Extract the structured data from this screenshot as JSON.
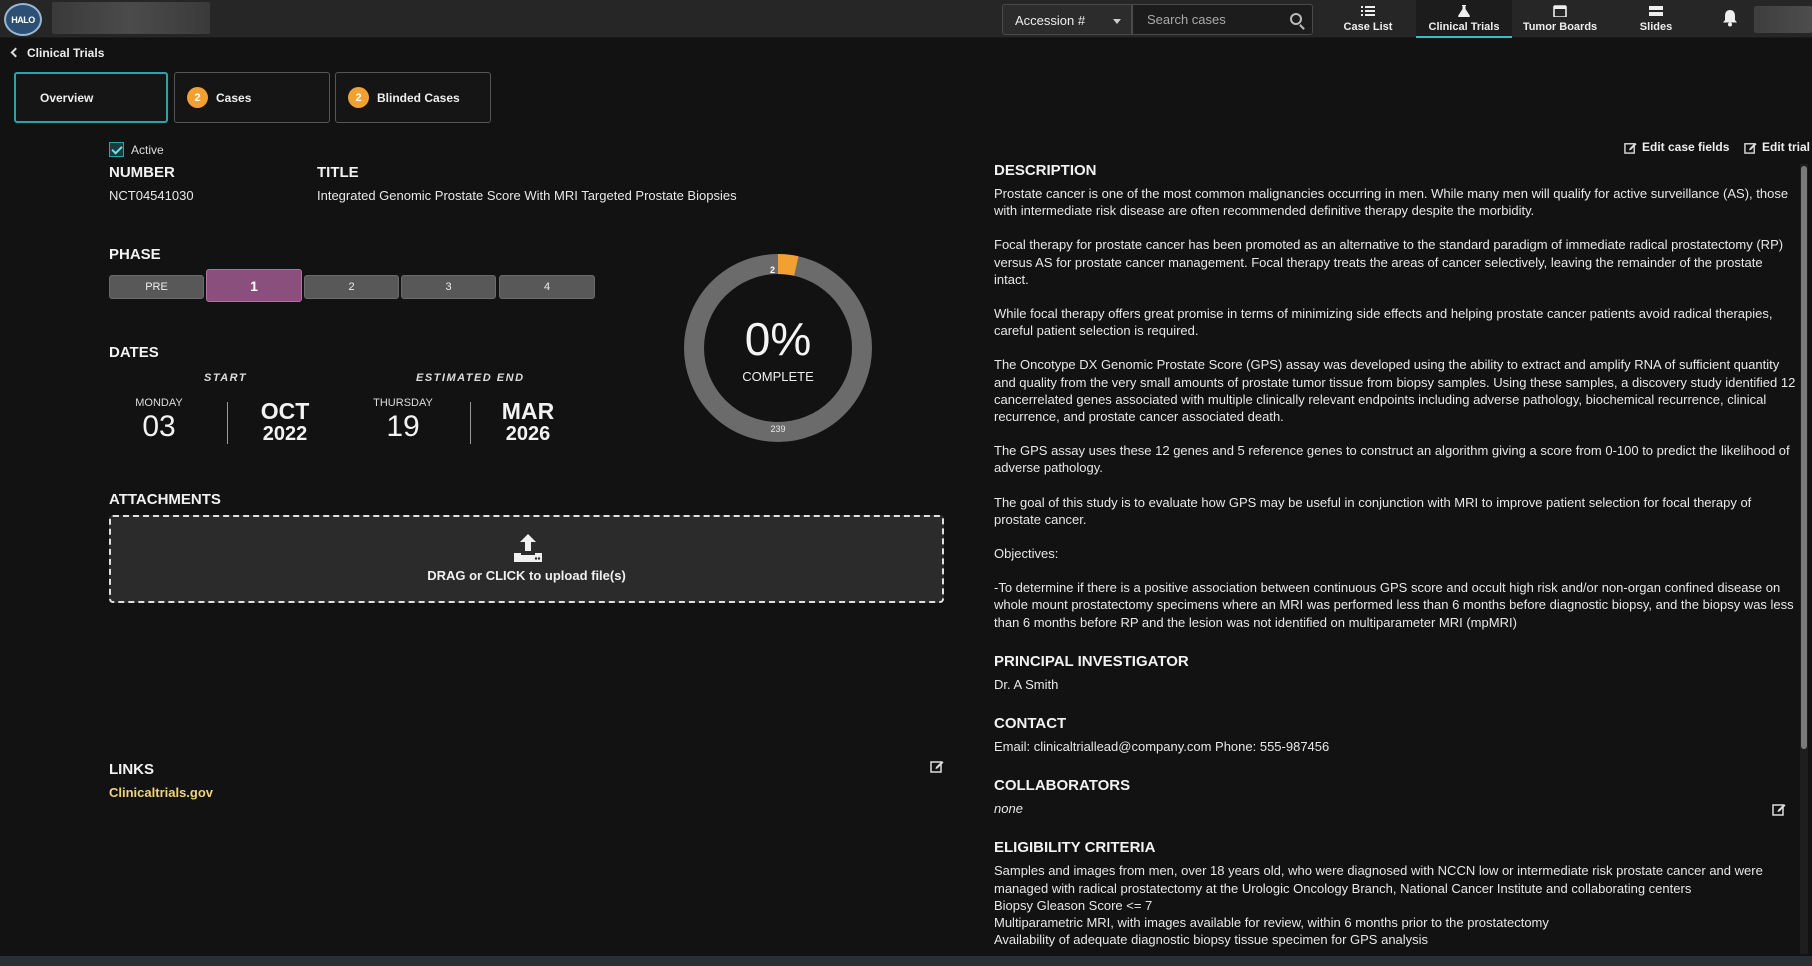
{
  "header": {
    "logo_text": "HALO",
    "accession_select": "Accession #",
    "search_placeholder": "Search cases",
    "nav": [
      {
        "label": "Case List",
        "icon": "list-icon"
      },
      {
        "label": "Clinical Trials",
        "icon": "flask-icon",
        "active": true
      },
      {
        "label": "Tumor Boards",
        "icon": "calendar-icon"
      },
      {
        "label": "Slides",
        "icon": "slides-icon"
      }
    ],
    "accent_color": "#2ec1c9"
  },
  "breadcrumb": "Clinical Trials",
  "subtabs": [
    {
      "label": "Overview",
      "badge": null,
      "active": true
    },
    {
      "label": "Cases",
      "badge": "2"
    },
    {
      "label": "Blinded Cases",
      "badge": "2"
    }
  ],
  "trial": {
    "active_label": "Active",
    "number_heading": "NUMBER",
    "number": "NCT04541030",
    "title_heading": "TITLE",
    "title": "Integrated Genomic Prostate Score With MRI Targeted Prostate Biopsies",
    "phase_heading": "PHASE",
    "phases": [
      "PRE",
      "1",
      "2",
      "3",
      "4"
    ],
    "active_phase": "1",
    "dates_heading": "DATES",
    "start": {
      "caption": "START",
      "weekday": "MONDAY",
      "day": "03",
      "month": "OCT",
      "year": "2022"
    },
    "end": {
      "caption": "ESTIMATED END",
      "weekday": "THURSDAY",
      "day": "19",
      "month": "MAR",
      "year": "2026"
    },
    "attachments_heading": "ATTACHMENTS",
    "upload_text": "DRAG or CLICK to upload file(s)",
    "links_heading": "LINKS",
    "link": "Clinicaltrials.gov"
  },
  "progress": {
    "percent_label": "0%",
    "complete_label": "COMPLETE",
    "enrolled": 2,
    "enrolled_label": "2",
    "total": 239,
    "total_label": "239",
    "ring_color": "#6b6b6b",
    "progress_color": "#f3a033"
  },
  "actions": {
    "edit_case_fields": "Edit case fields",
    "edit_trial": "Edit trial"
  },
  "details": {
    "description_heading": "DESCRIPTION",
    "description": [
      "Prostate cancer is one of the most common malignancies occurring in men. While many men will qualify for active surveillance (AS), those with intermediate risk disease are often recommended definitive therapy despite the morbidity.",
      "Focal therapy for prostate cancer has been promoted as an alternative to the standard paradigm of immediate radical prostatectomy (RP) versus AS for prostate cancer management. Focal therapy treats the areas of cancer selectively, leaving the remainder of the prostate intact.",
      "While focal therapy offers great promise in terms of minimizing side effects and helping prostate cancer patients avoid radical therapies, careful patient selection is required.",
      "The Oncotype DX Genomic Prostate Score (GPS) assay was developed using the ability to extract and amplify RNA of sufficient quantity and quality from the very small amounts of prostate tumor tissue from biopsy samples. Using these samples, a discovery study identified 12 cancerrelated genes associated with multiple clinically relevant endpoints including adverse pathology, biochemical recurrence, clinical recurrence, and prostate cancer associated death.",
      "The GPS assay uses these 12 genes and 5 reference genes to construct an algorithm giving a score from 0-100 to predict the likelihood of adverse pathology.",
      "The goal of this study is to evaluate how GPS may be useful in conjunction with MRI to improve patient selection for focal therapy of prostate cancer.",
      "Objectives:",
      "-To determine if there is a positive association between continuous GPS score and occult high risk and/or non-organ confined disease on whole mount prostatectomy specimens where an MRI was performed less than 6 months before diagnostic biopsy, and the biopsy was less than 6 months before RP and the lesion was not identified on multiparameter MRI (mpMRI)"
    ],
    "pi_heading": "PRINCIPAL INVESTIGATOR",
    "pi": "Dr. A Smith",
    "contact_heading": "CONTACT",
    "contact": "Email: clinicaltriallead@company.com Phone: 555-987456",
    "collaborators_heading": "COLLABORATORS",
    "collaborators": "none",
    "eligibility_heading": "ELIGIBILITY CRITERIA",
    "eligibility": [
      "Samples and images from men, over 18 years old, who were diagnosed with NCCN low or intermediate risk prostate cancer and were managed with radical prostatectomy at the Urologic Oncology Branch, National Cancer Institute and collaborating centers",
      "Biopsy Gleason Score <= 7",
      "Multiparametric MRI, with images available for review, within 6 months prior to the prostatectomy",
      "Availability of adequate diagnostic biopsy tissue specimen for GPS analysis"
    ]
  }
}
